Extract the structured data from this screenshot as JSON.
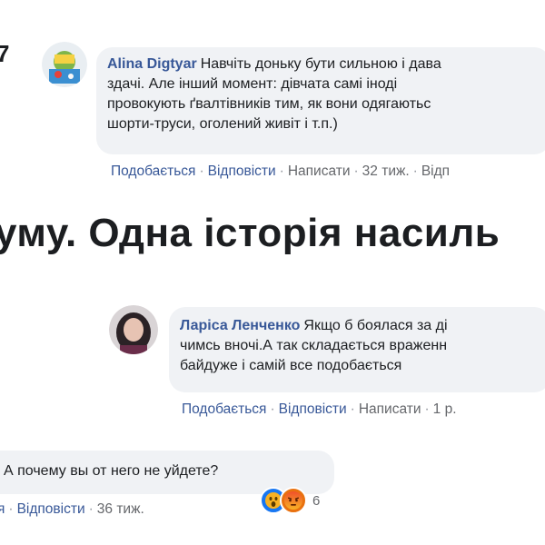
{
  "edge_char": "7",
  "headline": "уму. Одна історія насиль",
  "comments": [
    {
      "author": "Alina Digtyar",
      "lines": [
        "Навчіть доньку бути сильною і дава",
        "здачі. Але інший момент: дівчата самі іноді",
        "провокують ґвалтівників тим, як вони одягаютьс",
        "шорти-труси, оголений живіт і т.п.)"
      ],
      "actions": {
        "like": "Подобається",
        "reply": "Відповісти",
        "write": "Написати",
        "time": "32 тиж.",
        "extra": "Відп"
      }
    },
    {
      "author": "Ларіса Ленченко",
      "lines": [
        "Якщо б боялася за ді",
        "чимсь вночі.А так складається враженн",
        "байдуже і самій все подобається"
      ],
      "actions": {
        "like": "Подобається",
        "reply": "Відповісти",
        "write": "Написати",
        "time": "1 р."
      }
    },
    {
      "text": "А почему вы от него не уйдете?",
      "actions": {
        "like": "я",
        "reply": "Відповісти",
        "time": "36 тиж."
      },
      "reactions": {
        "icons": [
          "wow-reaction-icon",
          "angry-reaction-icon"
        ],
        "count": "6"
      }
    }
  ],
  "colors": {
    "author": "#385898",
    "bubble": "#f0f2f5",
    "meta": "#65676b"
  }
}
